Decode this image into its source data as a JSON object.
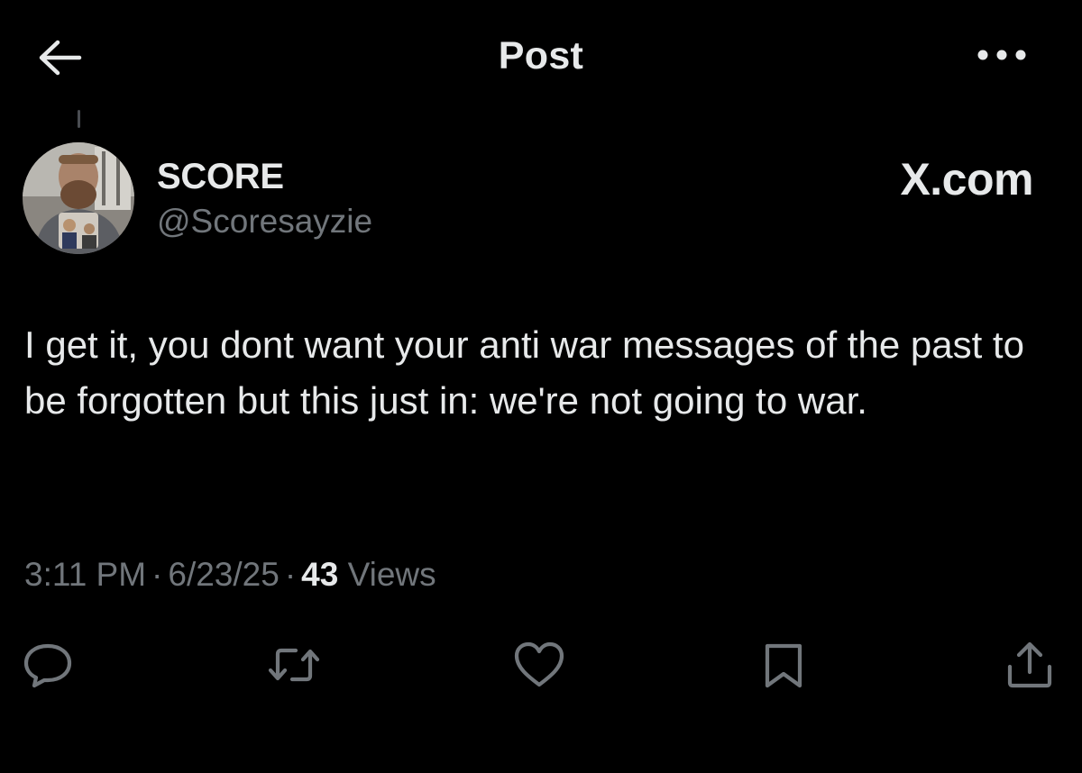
{
  "header": {
    "title": "Post",
    "back_icon": "arrow-left-icon",
    "more_icon": "more-horizontal-icon"
  },
  "post": {
    "author": {
      "display_name": "SCORE",
      "handle": "@Scoresayzie"
    },
    "watermark": "X.com",
    "text": "I get it, you dont want your anti war messages of the past to be forgotten but this just in: we're not going to war.",
    "time": "3:11 PM",
    "date": "6/23/25",
    "separator": "·",
    "views_count": "43",
    "views_label": "Views"
  },
  "actions": [
    {
      "icon": "reply-icon"
    },
    {
      "icon": "repost-icon"
    },
    {
      "icon": "like-icon"
    },
    {
      "icon": "bookmark-icon"
    },
    {
      "icon": "share-icon"
    }
  ],
  "colors": {
    "background": "#000000",
    "primary_text": "#e7e9ea",
    "secondary_text": "#71767b"
  }
}
